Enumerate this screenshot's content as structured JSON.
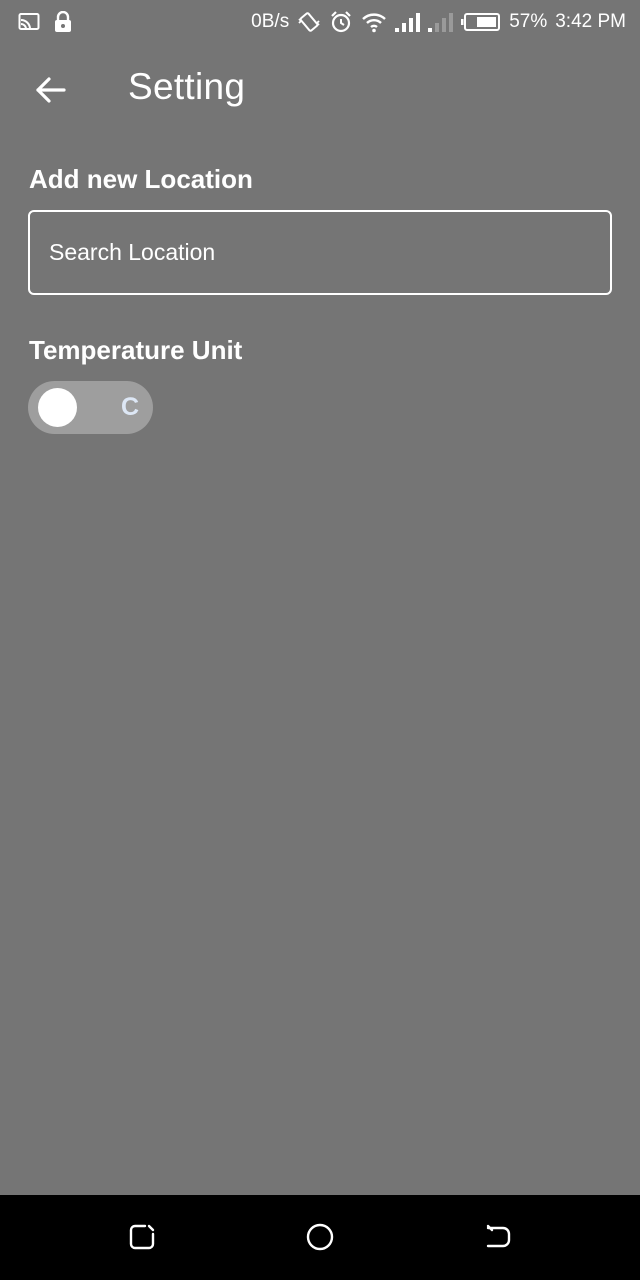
{
  "status_bar": {
    "network_speed": "0B/s",
    "battery_percent": "57%",
    "time": "3:42 PM",
    "icons": [
      "cast-icon",
      "lock-icon",
      "vibrate-icon",
      "alarm-icon",
      "wifi-icon",
      "signal-icon",
      "battery-icon"
    ]
  },
  "app_bar": {
    "title": "Setting",
    "back_icon": "arrow-left-icon"
  },
  "location": {
    "label": "Add new Location",
    "placeholder": "Search Location",
    "value": ""
  },
  "temperature": {
    "label": "Temperature Unit",
    "toggle_text": "C",
    "toggle_on": false
  },
  "nav_bar": {
    "icons": [
      "recent-apps-icon",
      "home-icon",
      "back-nav-icon"
    ]
  },
  "colors": {
    "background": "#757575",
    "toggle_track": "#9e9e9e",
    "nav_background": "#000000"
  }
}
